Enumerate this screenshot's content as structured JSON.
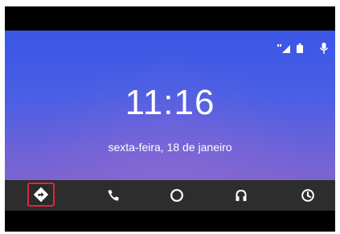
{
  "status": {
    "icons": [
      "signal-icon",
      "battery-icon",
      "mic-icon"
    ]
  },
  "clock": {
    "time": "11:16",
    "date": "sexta-feira, 18 de janeiro"
  },
  "nav": {
    "items": [
      {
        "name": "navigation",
        "icon": "navigation-arrow-icon",
        "highlighted": true
      },
      {
        "name": "phone",
        "icon": "phone-icon"
      },
      {
        "name": "home",
        "icon": "home-circle-icon"
      },
      {
        "name": "music",
        "icon": "headphones-icon"
      },
      {
        "name": "exit",
        "icon": "exit-icon"
      }
    ]
  },
  "colors": {
    "screen_top": "#3b56e6",
    "screen_bottom": "#7d64cf",
    "nav_bar": "#2d2d2d",
    "highlight": "#e0253e"
  }
}
